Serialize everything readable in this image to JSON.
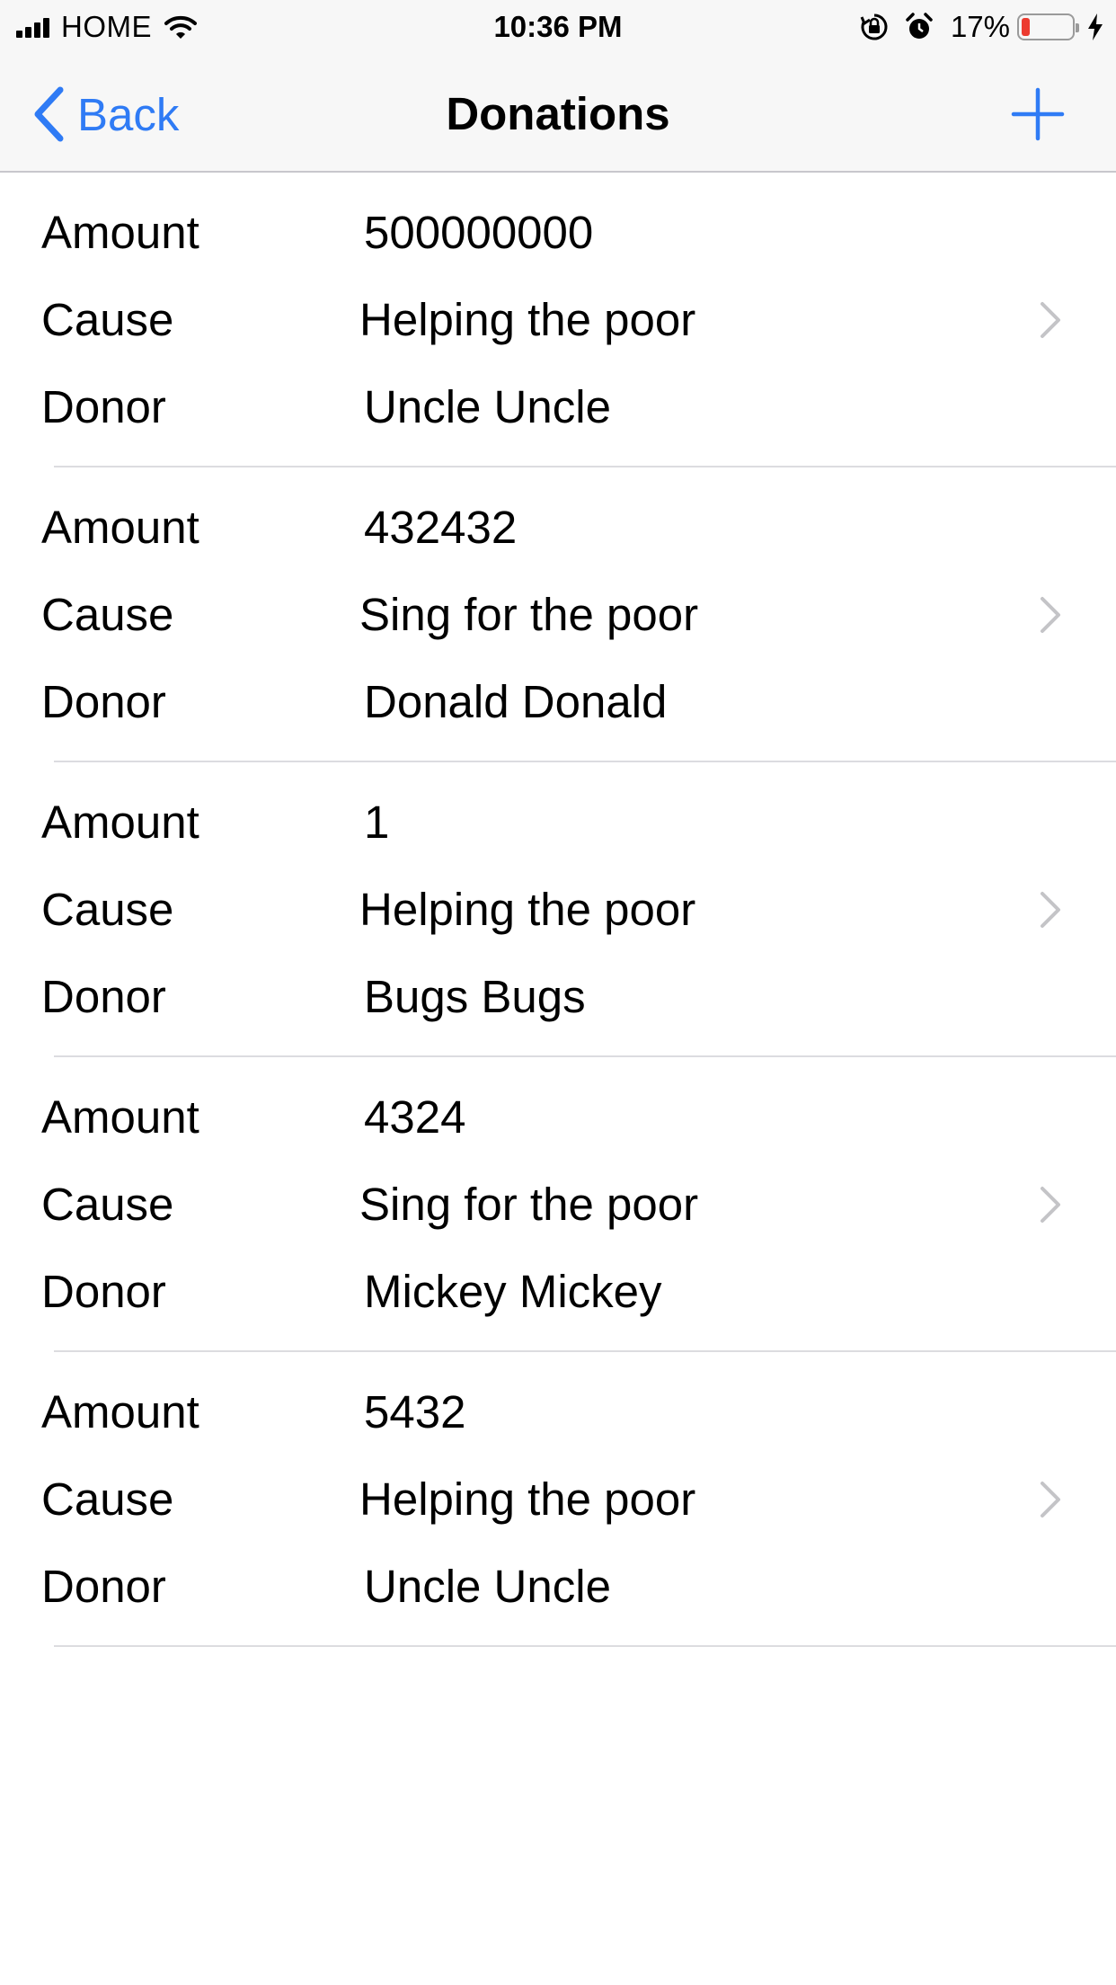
{
  "status_bar": {
    "carrier": "HOME",
    "time": "10:36 PM",
    "battery_percent": "17%",
    "battery_level": 0.17,
    "battery_color": "#ec3b30"
  },
  "nav": {
    "back_label": "Back",
    "title": "Donations",
    "accent_color": "#2f7bf5"
  },
  "labels": {
    "amount": "Amount",
    "cause": "Cause",
    "donor": "Donor"
  },
  "donations": [
    {
      "amount": "500000000",
      "cause": "Helping the poor",
      "donor": "Uncle Uncle"
    },
    {
      "amount": "432432",
      "cause": "Sing for the poor",
      "donor": "Donald Donald"
    },
    {
      "amount": "1",
      "cause": "Helping the poor",
      "donor": "Bugs Bugs"
    },
    {
      "amount": "4324",
      "cause": "Sing for the poor",
      "donor": "Mickey Mickey"
    },
    {
      "amount": "5432",
      "cause": "Helping the poor",
      "donor": "Uncle Uncle"
    }
  ]
}
